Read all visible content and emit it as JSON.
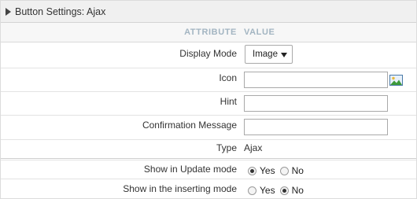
{
  "panel": {
    "title": "Button Settings: Ajax"
  },
  "columns": {
    "attribute": "ATTRIBUTE",
    "value": "VALUE"
  },
  "fields": {
    "display_mode": {
      "label": "Display Mode",
      "selected": "Image"
    },
    "icon": {
      "label": "Icon",
      "value": "",
      "picker_icon": "image-icon"
    },
    "hint": {
      "label": "Hint",
      "value": ""
    },
    "confirmation_message": {
      "label": "Confirmation Message",
      "value": ""
    },
    "type": {
      "label": "Type",
      "value": "Ajax"
    },
    "show_in_update_mode": {
      "label": "Show in Update mode",
      "options": [
        "Yes",
        "No"
      ],
      "selected": "Yes"
    },
    "show_in_inserting_mode": {
      "label": "Show in the inserting mode",
      "options": [
        "Yes",
        "No"
      ],
      "selected": "No"
    }
  }
}
